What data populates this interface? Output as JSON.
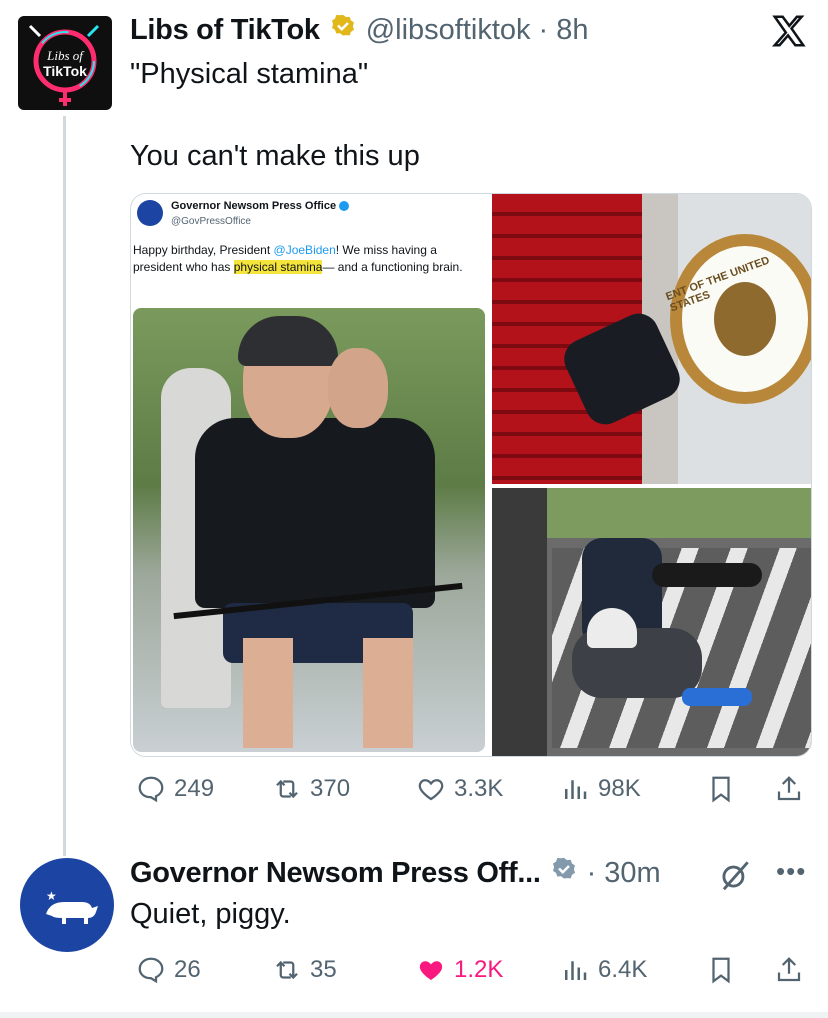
{
  "tweet1": {
    "avatar_text": "Libs of TikTok",
    "name": "Libs of TikTok",
    "handle": "@libsoftiktok",
    "time": "8h",
    "quote_line": "\"Physical stamina\"",
    "text": "You can't make this up",
    "stats": {
      "replies": "249",
      "reposts": "370",
      "likes": "3.3K",
      "views": "98K"
    }
  },
  "embedded": {
    "name": "Governor Newsom Press Office",
    "handle": "@GovPressOffice",
    "text_before": "Happy birthday, President ",
    "mention": "@JoeBiden",
    "text_mid": "! We miss having a president who has ",
    "highlight": "physical stamina",
    "text_after": "— and a functioning brain.",
    "seal_text": "ENT OF THE UNITED STATES"
  },
  "tweet2": {
    "name": "Governor Newsom Press Off...",
    "time": "30m",
    "text": "Quiet, piggy.",
    "stats": {
      "replies": "26",
      "reposts": "35",
      "likes": "1.2K",
      "views": "6.4K"
    }
  },
  "colors": {
    "blue": "#1d9bf0",
    "gold_badge": "#e2b719",
    "grey": "#536471",
    "like_pink": "#f91880",
    "newsom_blue": "#1c44a3"
  }
}
